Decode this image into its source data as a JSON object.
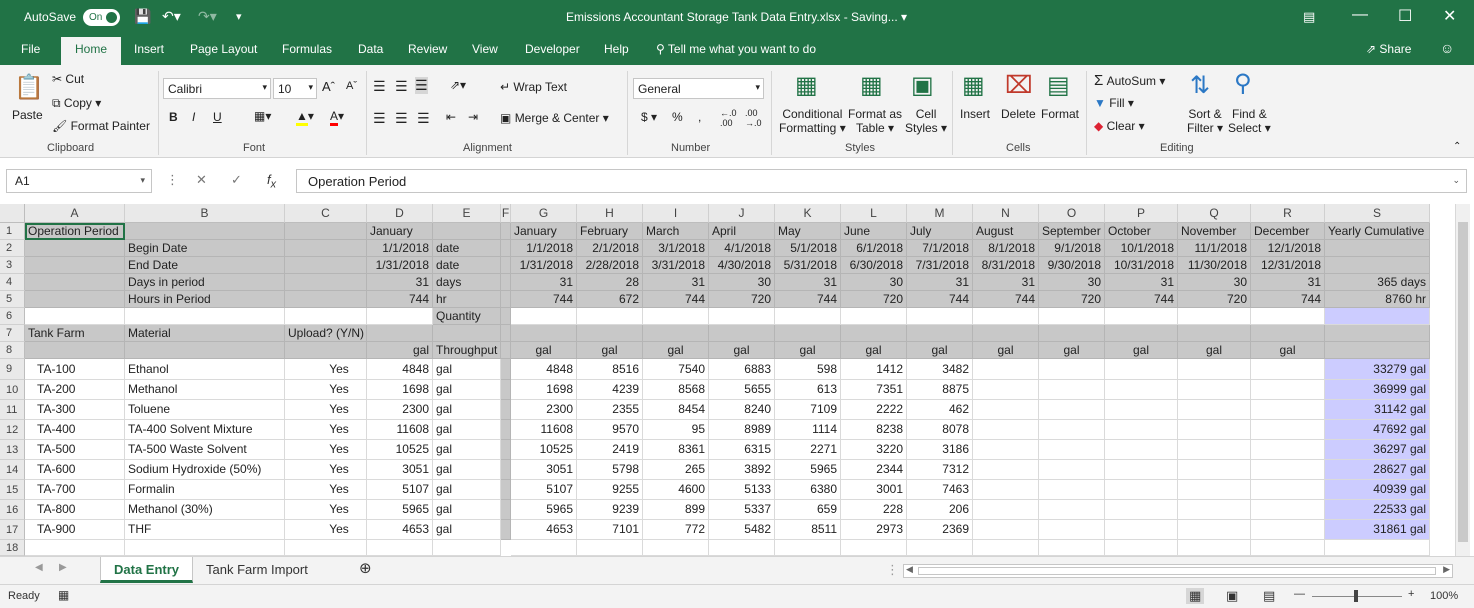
{
  "titlebar": {
    "autosave_label": "AutoSave",
    "autosave_state": "On",
    "title": "Emissions Accountant Storage Tank Data Entry.xlsx  -  Saving...  ▾"
  },
  "ribbon_tabs": [
    "File",
    "Home",
    "Insert",
    "Page Layout",
    "Formulas",
    "Data",
    "Review",
    "View",
    "Developer",
    "Help"
  ],
  "tell_me": "Tell me what you want to do",
  "share": "Share",
  "ribbon": {
    "clipboard": {
      "paste": "Paste",
      "cut": "Cut",
      "copy": "Copy",
      "format_painter": "Format Painter",
      "label": "Clipboard"
    },
    "font": {
      "name": "Calibri",
      "size": "10",
      "bold": "B",
      "italic": "I",
      "underline": "U",
      "label": "Font"
    },
    "alignment": {
      "wrap_text": "Wrap Text",
      "merge_center": "Merge & Center",
      "label": "Alignment"
    },
    "number": {
      "format": "General",
      "label": "Number"
    },
    "styles": {
      "conditional": "Conditional",
      "formatting": "Formatting",
      "format_as": "Format as",
      "table": "Table",
      "cell": "Cell",
      "cell_styles": "Styles",
      "label": "Styles"
    },
    "cells": {
      "insert": "Insert",
      "delete": "Delete",
      "format": "Format",
      "label": "Cells"
    },
    "editing": {
      "autosum": "AutoSum",
      "fill": "Fill",
      "clear": "Clear",
      "sort": "Sort &",
      "filter": "Filter",
      "find": "Find &",
      "select": "Select",
      "label": "Editing"
    }
  },
  "formula_bar": {
    "name_box": "A1",
    "formula": "Operation Period"
  },
  "grid": {
    "columns": [
      "A",
      "B",
      "C",
      "D",
      "E",
      "F",
      "G",
      "H",
      "I",
      "J",
      "K",
      "L",
      "M",
      "N",
      "O",
      "P",
      "Q",
      "R",
      "S"
    ],
    "rows": [
      "1",
      "2",
      "3",
      "4",
      "5",
      "6",
      "7",
      "8",
      "9",
      "10",
      "11",
      "12",
      "13",
      "14",
      "15",
      "16",
      "17",
      "18"
    ],
    "header_rows": {
      "r1": {
        "A": "Operation Period",
        "D": "January",
        "S": "Yearly Cumulative"
      },
      "r2": {
        "B": "Begin Date",
        "D": "1/1/2018",
        "E": "date"
      },
      "r3": {
        "B": "End Date",
        "D": "1/31/2018",
        "E": "date"
      },
      "r4": {
        "B": "Days in period",
        "D": "31",
        "E": "days",
        "S": "365 days"
      },
      "r5": {
        "B": "Hours in Period",
        "D": "744",
        "E": "hr",
        "S": "8760 hr"
      },
      "r6": {
        "E": "Quantity"
      },
      "r7": {
        "A": "Tank Farm",
        "B": "Material",
        "C": "Upload? (Y/N)"
      },
      "r8": {
        "D": "gal",
        "E": "Throughput"
      }
    },
    "months": [
      {
        "name": "January",
        "begin": "1/1/2018",
        "end": "1/31/2018",
        "days": "31",
        "hours": "744",
        "unit": "gal"
      },
      {
        "name": "February",
        "begin": "2/1/2018",
        "end": "2/28/2018",
        "days": "28",
        "hours": "672",
        "unit": "gal"
      },
      {
        "name": "March",
        "begin": "3/1/2018",
        "end": "3/31/2018",
        "days": "31",
        "hours": "744",
        "unit": "gal"
      },
      {
        "name": "April",
        "begin": "4/1/2018",
        "end": "4/30/2018",
        "days": "30",
        "hours": "720",
        "unit": "gal"
      },
      {
        "name": "May",
        "begin": "5/1/2018",
        "end": "5/31/2018",
        "days": "31",
        "hours": "744",
        "unit": "gal"
      },
      {
        "name": "June",
        "begin": "6/1/2018",
        "end": "6/30/2018",
        "days": "30",
        "hours": "720",
        "unit": "gal"
      },
      {
        "name": "July",
        "begin": "7/1/2018",
        "end": "7/31/2018",
        "days": "31",
        "hours": "744",
        "unit": "gal"
      },
      {
        "name": "August",
        "begin": "8/1/2018",
        "end": "8/31/2018",
        "days": "31",
        "hours": "744",
        "unit": "gal"
      },
      {
        "name": "September",
        "begin": "9/1/2018",
        "end": "9/30/2018",
        "days": "30",
        "hours": "720",
        "unit": "gal"
      },
      {
        "name": "October",
        "begin": "10/1/2018",
        "end": "10/31/2018",
        "days": "31",
        "hours": "744",
        "unit": "gal"
      },
      {
        "name": "November",
        "begin": "11/1/2018",
        "end": "11/30/2018",
        "days": "30",
        "hours": "720",
        "unit": "gal"
      },
      {
        "name": "December",
        "begin": "12/1/2018",
        "end": "12/31/2018",
        "days": "31",
        "hours": "744",
        "unit": "gal"
      }
    ],
    "tanks": [
      {
        "tank": "TA-100",
        "material": "Ethanol",
        "upload": "Yes",
        "qty": "4848",
        "unit": "gal",
        "monthly": [
          "4848",
          "8516",
          "7540",
          "6883",
          "598",
          "1412",
          "3482"
        ],
        "cumulative": "33279 gal"
      },
      {
        "tank": "TA-200",
        "material": "Methanol",
        "upload": "Yes",
        "qty": "1698",
        "unit": "gal",
        "monthly": [
          "1698",
          "4239",
          "8568",
          "5655",
          "613",
          "7351",
          "8875"
        ],
        "cumulative": "36999 gal"
      },
      {
        "tank": "TA-300",
        "material": "Toluene",
        "upload": "Yes",
        "qty": "2300",
        "unit": "gal",
        "monthly": [
          "2300",
          "2355",
          "8454",
          "8240",
          "7109",
          "2222",
          "462"
        ],
        "cumulative": "31142 gal"
      },
      {
        "tank": "TA-400",
        "material": "TA-400 Solvent Mixture",
        "upload": "Yes",
        "qty": "11608",
        "unit": "gal",
        "monthly": [
          "11608",
          "9570",
          "95",
          "8989",
          "1114",
          "8238",
          "8078"
        ],
        "cumulative": "47692 gal"
      },
      {
        "tank": "TA-500",
        "material": "TA-500 Waste Solvent",
        "upload": "Yes",
        "qty": "10525",
        "unit": "gal",
        "monthly": [
          "10525",
          "2419",
          "8361",
          "6315",
          "2271",
          "3220",
          "3186"
        ],
        "cumulative": "36297 gal"
      },
      {
        "tank": "TA-600",
        "material": "Sodium Hydroxide (50%)",
        "upload": "Yes",
        "qty": "3051",
        "unit": "gal",
        "monthly": [
          "3051",
          "5798",
          "265",
          "3892",
          "5965",
          "2344",
          "7312"
        ],
        "cumulative": "28627 gal"
      },
      {
        "tank": "TA-700",
        "material": "Formalin",
        "upload": "Yes",
        "qty": "5107",
        "unit": "gal",
        "monthly": [
          "5107",
          "9255",
          "4600",
          "5133",
          "6380",
          "3001",
          "7463"
        ],
        "cumulative": "40939 gal"
      },
      {
        "tank": "TA-800",
        "material": "Methanol (30%)",
        "upload": "Yes",
        "qty": "5965",
        "unit": "gal",
        "monthly": [
          "5965",
          "9239",
          "899",
          "5337",
          "659",
          "228",
          "206"
        ],
        "cumulative": "22533 gal"
      },
      {
        "tank": "TA-900",
        "material": "THF",
        "upload": "Yes",
        "qty": "4653",
        "unit": "gal",
        "monthly": [
          "4653",
          "7101",
          "772",
          "5482",
          "8511",
          "2973",
          "2369"
        ],
        "cumulative": "31861 gal"
      }
    ]
  },
  "sheet_tabs": [
    "Data Entry",
    "Tank Farm Import"
  ],
  "status": {
    "ready": "Ready",
    "zoom": "100%"
  }
}
